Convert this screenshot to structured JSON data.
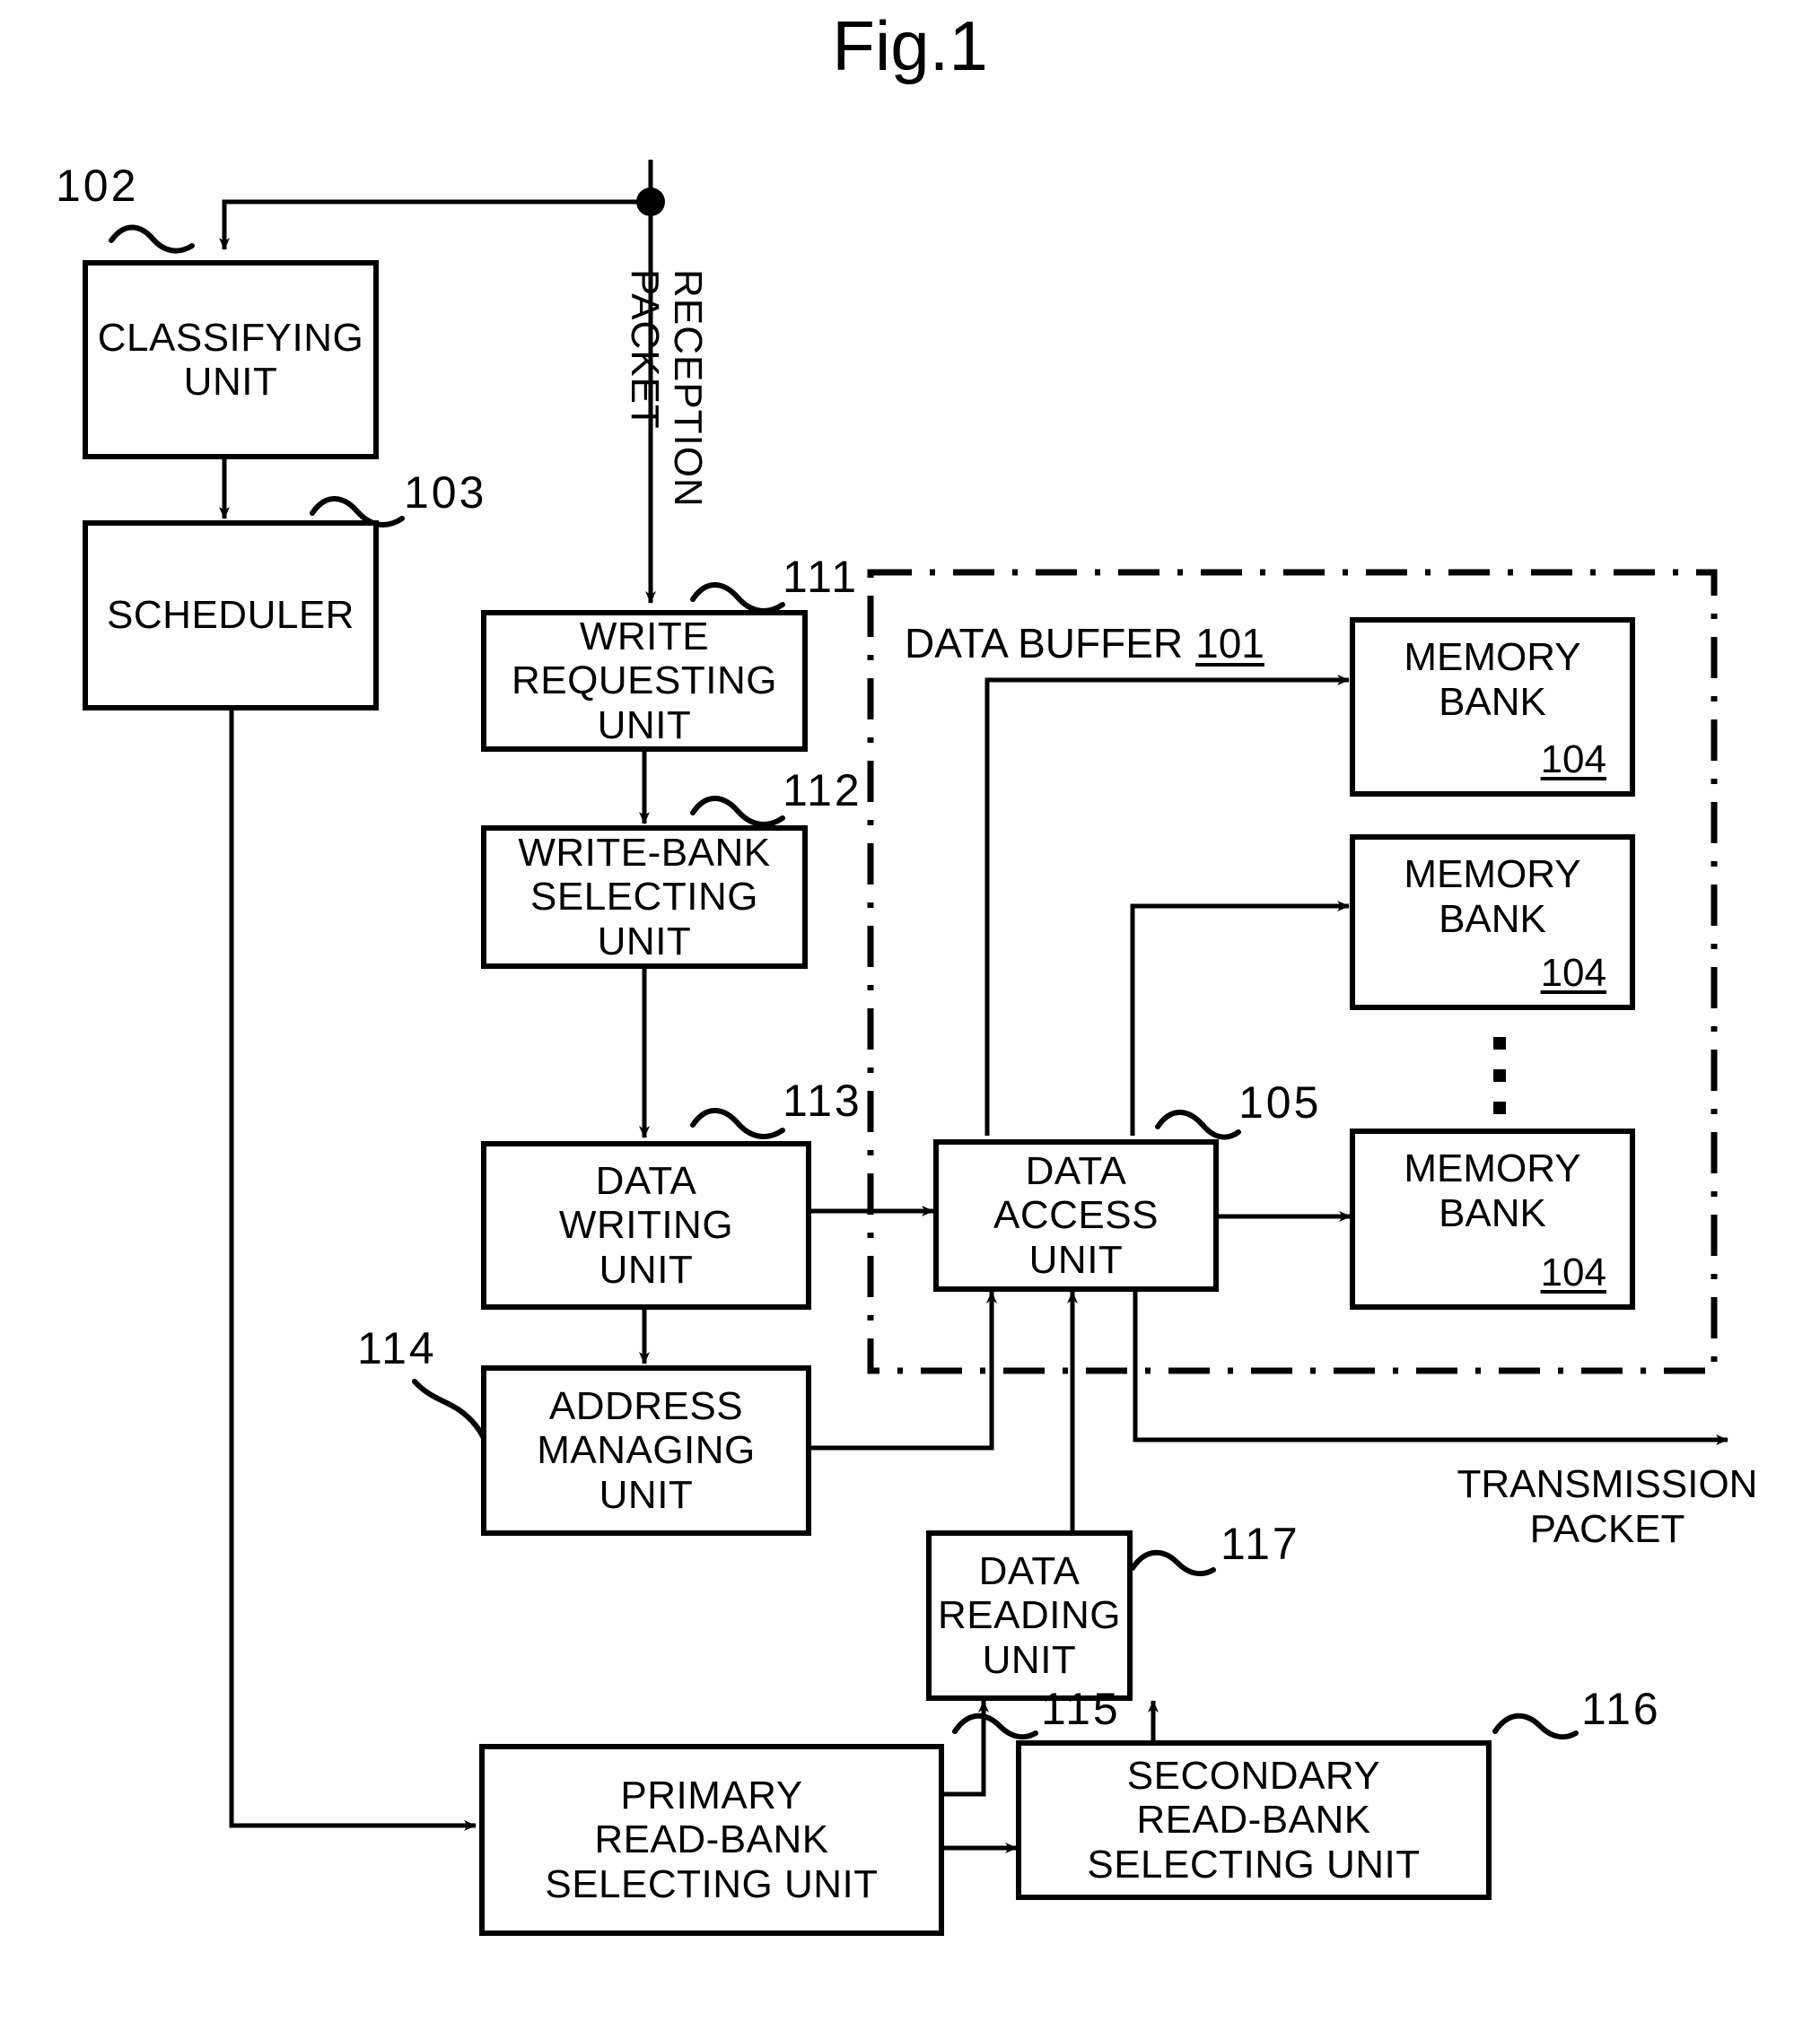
{
  "figure": {
    "title": "Fig.1"
  },
  "flow_labels": {
    "reception_packet": "RECEPTION\nPACKET",
    "transmission_packet": "TRANSMISSION\nPACKET"
  },
  "data_buffer": {
    "label": "DATA BUFFER",
    "ref": "101"
  },
  "blocks": [
    {
      "id": "classifying-unit",
      "label": "CLASSIFYING\nUNIT",
      "ref": "102"
    },
    {
      "id": "scheduler",
      "label": "SCHEDULER",
      "ref": "103"
    },
    {
      "id": "write-requesting-unit",
      "label": "WRITE\nREQUESTING\nUNIT",
      "ref": "111"
    },
    {
      "id": "write-bank-selecting-unit",
      "label": "WRITE-BANK\nSELECTING\nUNIT",
      "ref": "112"
    },
    {
      "id": "data-writing-unit",
      "label": "DATA\nWRITING\nUNIT",
      "ref": "113"
    },
    {
      "id": "address-managing-unit",
      "label": "ADDRESS\nMANAGING\nUNIT",
      "ref": "114"
    },
    {
      "id": "data-access-unit",
      "label": "DATA\nACCESS\nUNIT",
      "ref": "105"
    },
    {
      "id": "data-reading-unit",
      "label": "DATA\nREADING\nUNIT",
      "ref": "117"
    },
    {
      "id": "primary-read-bank-selecting-unit",
      "label": "PRIMARY\nREAD-BANK\nSELECTING UNIT",
      "ref": "115"
    },
    {
      "id": "secondary-read-bank-selecting-unit",
      "label": "SECONDARY\nREAD-BANK\nSELECTING UNIT",
      "ref": "116"
    }
  ],
  "memory_banks": [
    {
      "label": "MEMORY\nBANK",
      "ref": "104"
    },
    {
      "label": "MEMORY\nBANK",
      "ref": "104"
    },
    {
      "label": "MEMORY\nBANK",
      "ref": "104"
    }
  ],
  "colors": {
    "ink": "#000000",
    "paper": "#ffffff"
  }
}
